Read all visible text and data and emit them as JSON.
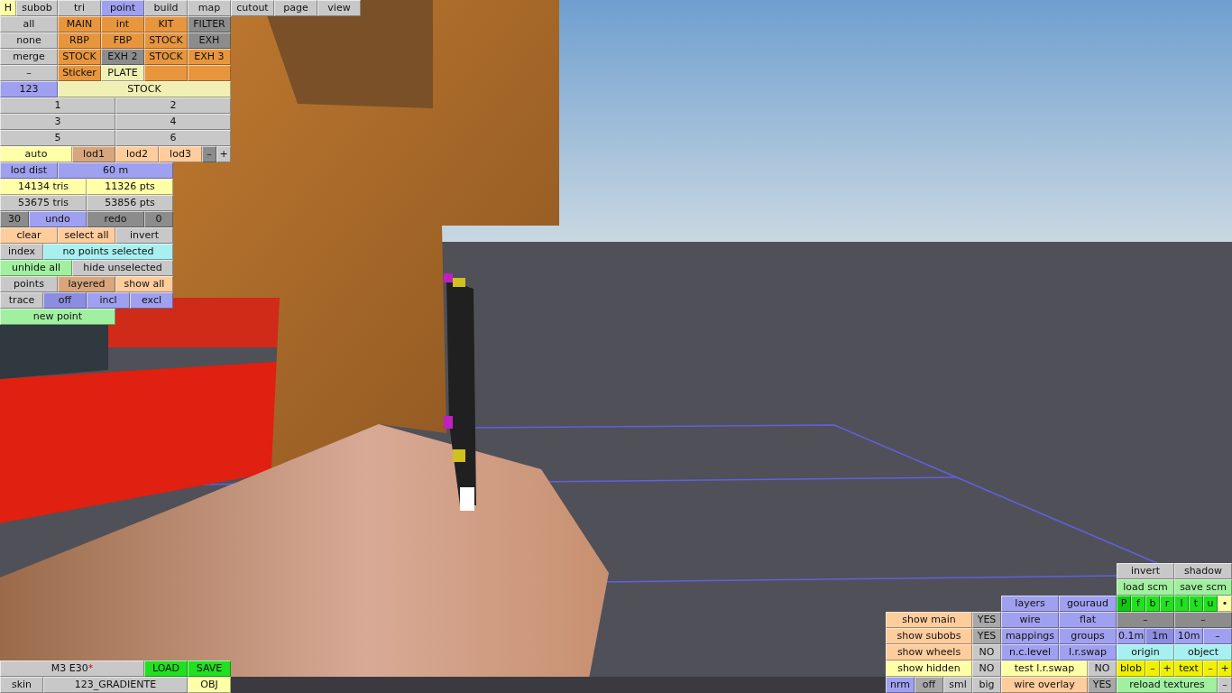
{
  "tab_bar": {
    "h_button": {
      "label": "H",
      "color": "#ffffa8"
    },
    "tabs": [
      {
        "label": "subob",
        "selected": false
      },
      {
        "label": "tri",
        "selected": false
      },
      {
        "label": "point",
        "selected": true
      },
      {
        "label": "build",
        "selected": false
      },
      {
        "label": "map",
        "selected": false
      },
      {
        "label": "cutout",
        "selected": false
      },
      {
        "label": "page",
        "selected": false
      },
      {
        "label": "view",
        "selected": false
      }
    ]
  },
  "left_panel": {
    "rows": [
      [
        {
          "label": "all",
          "color": "#c8c8c8"
        },
        {
          "label": "MAIN",
          "color": "#e8963e"
        },
        {
          "label": "int",
          "color": "#e8963e"
        },
        {
          "label": "KIT",
          "color": "#e8963e"
        },
        {
          "label": "FILTER",
          "color": "#8c8c8c"
        }
      ],
      [
        {
          "label": "none",
          "color": "#c8c8c8"
        },
        {
          "label": "RBP",
          "color": "#e8963e"
        },
        {
          "label": "FBP",
          "color": "#e8963e"
        },
        {
          "label": "STOCK",
          "color": "#e8963e"
        },
        {
          "label": "EXH",
          "color": "#8c8c8c"
        }
      ],
      [
        {
          "label": "merge",
          "color": "#c8c8c8"
        },
        {
          "label": "STOCK",
          "color": "#e8963e"
        },
        {
          "label": "EXH 2",
          "color": "#8c8c8c"
        },
        {
          "label": "STOCK",
          "color": "#e8963e"
        },
        {
          "label": "EXH 3",
          "color": "#e8963e"
        }
      ],
      [
        {
          "label": "–",
          "color": "#c8c8c8"
        },
        {
          "label": "Sticker",
          "color": "#e8963e"
        },
        {
          "label": "PLATE",
          "color": "#f0f0b4"
        },
        {
          "color": "#e8963e"
        },
        {
          "color": "#e8963e"
        }
      ],
      [
        {
          "label": "123",
          "color": "#a0a0f0"
        },
        {
          "label": "STOCK",
          "color": "#f0f0b4"
        }
      ],
      [
        {
          "label": "1",
          "color": "#c8c8c8"
        },
        {
          "label": "2",
          "color": "#c8c8c8"
        }
      ],
      [
        {
          "label": "3",
          "color": "#c8c8c8"
        },
        {
          "label": "4",
          "color": "#c8c8c8"
        }
      ],
      [
        {
          "label": "5",
          "color": "#c8c8c8"
        },
        {
          "label": "6",
          "color": "#c8c8c8"
        }
      ],
      [
        {
          "label": "auto",
          "color": "#ffffa8"
        },
        {
          "label": "lod1",
          "color": "#d8a67c"
        },
        {
          "label": "lod2",
          "color": "#ffcc9c"
        },
        {
          "label": "lod3",
          "color": "#ffcc9c"
        },
        {
          "label": "–",
          "color": "#8c8c8c"
        },
        {
          "label": "+",
          "color": "#c8c8c8"
        }
      ],
      [
        {
          "label": "lod dist",
          "color": "#a0a0f0"
        },
        {
          "label": "60 m",
          "color": "#a0a0f0"
        }
      ],
      [
        {
          "label": "14134 tris",
          "color": "#ffffa8"
        },
        {
          "label": "11326 pts",
          "color": "#ffffa8"
        }
      ],
      [
        {
          "label": "53675 tris",
          "color": "#c8c8c8"
        },
        {
          "label": "53856 pts",
          "color": "#c8c8c8"
        }
      ],
      [
        {
          "label": "30",
          "color": "#8c8c8c"
        },
        {
          "label": "undo",
          "color": "#a0a0f0"
        },
        {
          "label": "redo",
          "color": "#8c8c8c"
        },
        {
          "label": "0",
          "color": "#8c8c8c"
        }
      ],
      [
        {
          "label": "clear",
          "color": "#ffcc9c"
        },
        {
          "label": "select all",
          "color": "#ffcc9c"
        },
        {
          "label": "invert",
          "color": "#c8c8c8"
        }
      ],
      [
        {
          "label": "index",
          "color": "#c8c8c8"
        },
        {
          "label": "no points selected",
          "color": "#a8f0f0"
        }
      ],
      [
        {
          "label": "unhide all",
          "color": "#a0f0a0"
        },
        {
          "label": "hide unselected",
          "color": "#c8c8c8"
        }
      ],
      [
        {
          "label": "points",
          "color": "#c8c8c8"
        },
        {
          "label": "layered",
          "color": "#d8a67c"
        },
        {
          "label": "show all",
          "color": "#ffcc9c"
        }
      ],
      [
        {
          "label": "trace",
          "color": "#c8c8c8"
        },
        {
          "label": "off",
          "color": "#8c8ce0"
        },
        {
          "label": "incl",
          "color": "#a0a0f0"
        },
        {
          "label": "excl",
          "color": "#a0a0f0"
        }
      ],
      [
        {
          "label": "new point",
          "color": "#a0f0a0"
        }
      ]
    ]
  },
  "file_panel": {
    "rows": [
      [
        {
          "label": "M3 E30",
          "suffix": "*",
          "color": "#c8c8c8"
        },
        {
          "label": "LOAD",
          "color": "#20e020"
        },
        {
          "label": "SAVE",
          "color": "#20e020"
        }
      ],
      [
        {
          "label": "skin",
          "color": "#c8c8c8"
        },
        {
          "label": "123_GRADIENTE",
          "color": "#c8c8c8"
        },
        {
          "label": "OBJ",
          "color": "#ffffa8"
        }
      ]
    ]
  },
  "display_panel": {
    "rows": [
      [
        {},
        {},
        {
          "label": "layers",
          "color": "#a0a0f0"
        },
        {
          "label": "gouraud",
          "color": "#a0a0f0"
        }
      ],
      [
        {
          "label": "show main",
          "color": "#ffcc9c"
        },
        {
          "label": "YES",
          "color": "#a8a8a8"
        },
        {
          "label": "wire",
          "color": "#a0a0f0"
        },
        {
          "label": "flat",
          "color": "#a0a0f0"
        }
      ],
      [
        {
          "label": "show subobs",
          "color": "#ffcc9c"
        },
        {
          "label": "YES",
          "color": "#a8a8a8"
        },
        {
          "label": "mappings",
          "color": "#a0a0f0"
        },
        {
          "label": "groups",
          "color": "#a0a0f0"
        }
      ],
      [
        {
          "label": "show wheels",
          "color": "#ffcc9c"
        },
        {
          "label": "NO",
          "color": "#c8c8c8"
        },
        {
          "label": "n.c.level",
          "color": "#a0a0f0"
        },
        {
          "label": "l.r.swap",
          "color": "#a0a0f0"
        }
      ],
      [
        {
          "label": "show hidden",
          "color": "#ffffa8"
        },
        {
          "label": "NO",
          "color": "#c8c8c8"
        },
        {
          "label": "test l.r.swap",
          "color": "#ffffa8"
        },
        {
          "label": "NO",
          "color": "#c8c8c8"
        }
      ],
      [
        {
          "group": [
            {
              "label": "nrm",
              "color": "#a0a0f0"
            },
            {
              "label": "off",
              "color": "#a8a8a8"
            },
            {
              "label": "sml",
              "color": "#c8c8c8"
            }
          ]
        },
        {
          "label": "big",
          "color": "#c8c8c8"
        },
        {
          "label": "wire overlay",
          "color": "#ffcc9c"
        },
        {
          "label": "YES",
          "color": "#a8a8a8"
        }
      ]
    ]
  },
  "tools_panel": {
    "rows": [
      [
        {
          "label": "invert",
          "color": "#c8c8c8"
        },
        {
          "label": "shadow",
          "color": "#c8c8c8"
        }
      ],
      [
        {
          "label": "load scm",
          "color": "#a0f0a0"
        },
        {
          "label": "save scm",
          "color": "#a0f0a0"
        }
      ],
      [
        {
          "group": [
            {
              "label": "P",
              "color": "#10c810"
            },
            {
              "label": "f",
              "color": "#20e020"
            },
            {
              "label": "b",
              "color": "#20e020"
            },
            {
              "label": "r",
              "color": "#20e020"
            }
          ]
        },
        {
          "group": [
            {
              "label": "l",
              "color": "#20e020"
            },
            {
              "label": "t",
              "color": "#20e020"
            },
            {
              "label": "u",
              "color": "#20e020"
            },
            {
              "label": "•",
              "color": "#ffffa8"
            }
          ]
        }
      ],
      [
        {
          "label": "–",
          "color": "#8c8c8c"
        },
        {
          "label": "–",
          "color": "#8c8c8c"
        }
      ],
      [
        {
          "group": [
            {
              "label": "0.1m",
              "color": "#a0a0f0"
            },
            {
              "label": "1m",
              "color": "#8c8ce0"
            }
          ]
        },
        {
          "group": [
            {
              "label": "10m",
              "color": "#a0a0f0"
            },
            {
              "label": "–",
              "color": "#a0a0f0"
            }
          ]
        }
      ],
      [
        {
          "label": "origin",
          "color": "#a8f0f0"
        },
        {
          "label": "object",
          "color": "#a8f0f0"
        }
      ],
      [
        {
          "group": [
            {
              "label": "blob",
              "color": "#f0f000"
            },
            {
              "label": "–",
              "color": "#f0f000"
            },
            {
              "label": "+",
              "color": "#f0f000"
            }
          ]
        },
        {
          "group": [
            {
              "label": "text",
              "color": "#f0f000"
            },
            {
              "label": "–",
              "color": "#f0f000"
            },
            {
              "label": "+",
              "color": "#f0f000"
            }
          ]
        }
      ],
      [
        {
          "group": [
            {
              "label": "reload textures",
              "color": "#a0f0a0"
            },
            {
              "label": "–",
              "color": "#c8c8c8"
            }
          ]
        }
      ]
    ]
  }
}
